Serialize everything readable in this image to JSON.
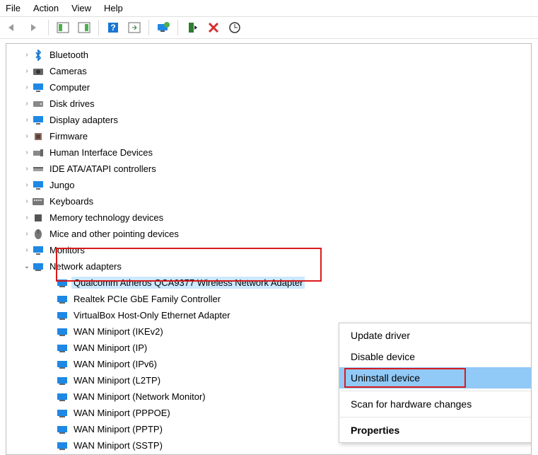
{
  "menu": {
    "file": "File",
    "action": "Action",
    "view": "View",
    "help": "Help"
  },
  "nodes": {
    "bluetooth": "Bluetooth",
    "cameras": "Cameras",
    "computer": "Computer",
    "disk": "Disk drives",
    "display": "Display adapters",
    "firmware": "Firmware",
    "hid": "Human Interface Devices",
    "ide": "IDE ATA/ATAPI controllers",
    "jungo": "Jungo",
    "keyboards": "Keyboards",
    "memtech": "Memory technology devices",
    "mice": "Mice and other pointing devices",
    "monitors": "Monitors",
    "netadapters": "Network adapters"
  },
  "net_children": {
    "qca": "Qualcomm Atheros QCA9377 Wireless Network Adapter",
    "realtek": "Realtek PCIe GbE Family Controller",
    "vbox": "VirtualBox Host-Only Ethernet Adapter",
    "wan_ikev2": "WAN Miniport (IKEv2)",
    "wan_ip": "WAN Miniport (IP)",
    "wan_ipv6": "WAN Miniport (IPv6)",
    "wan_l2tp": "WAN Miniport (L2TP)",
    "wan_netmon": "WAN Miniport (Network Monitor)",
    "wan_pppoe": "WAN Miniport (PPPOE)",
    "wan_pptp": "WAN Miniport (PPTP)",
    "wan_sstp": "WAN Miniport (SSTP)"
  },
  "context": {
    "update": "Update driver",
    "disable": "Disable device",
    "uninstall": "Uninstall device",
    "scan": "Scan for hardware changes",
    "properties": "Properties"
  }
}
